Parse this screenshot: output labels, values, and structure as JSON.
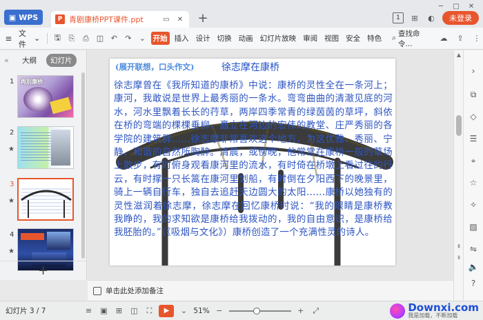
{
  "titlebar": {
    "wps_label": "WPS",
    "doc_name": "青剧康桥PPT课件.ppt",
    "page_badge": "1",
    "login": "未登录"
  },
  "ribbon": {
    "file_menu": "文件",
    "tabs": [
      "开始",
      "插入",
      "设计",
      "切换",
      "动画",
      "幻灯片放映",
      "审阅",
      "视图",
      "安全",
      "特色"
    ],
    "active_tab": "开始",
    "search_cmd": "查找命令..."
  },
  "left_panel": {
    "tab_outline": "大纲",
    "tab_slides": "幻灯片",
    "thumbs": [
      {
        "num": "1",
        "caption": "再别康桥"
      },
      {
        "num": "2"
      },
      {
        "num": "3"
      },
      {
        "num": "4"
      }
    ]
  },
  "slide": {
    "subtitle": "(展开联想，口头作文)",
    "title": "徐志摩在康桥",
    "body": "徐志摩曾在《我所知道的康桥》中说：康桥的灵性全在一条河上；康河，我敢说是世界上最秀丽的一条水。弯弯曲曲的清澈见底的河水，河水里飘着长长的荇草，两岸四季常青的绿茵茵的草坪，斜依在桥的弯端的棵棵垂柳，矗立在河边的宏伟的教堂、庄严秀丽的各学院的建筑群……徐志摩非常喜欢这个地方，为这优雅、秀丽、宁静、和谐的自然所陶醉。清晨，或傍晚，他常常在康桥一般的草场上散步，有时俯身观看康河里的流水，有时倚在桥墩上看过往的行云，有时撑一只长篙在康河里划船，有时倒在夕阳西下的晚景里，骑上一辆自行车，独自去追赶天边圆大的太阳……康桥以她独有的灵性滋润着徐志摩，徐志摩在回忆康桥时说：“我的眼睛是康桥教我睁的，我的求知欲是康桥给我拨动的，我的自由意识，是康桥给我胚胎的。”（《吸烟与文化》）康桥创造了一个充满性灵的诗人。"
  },
  "notes": {
    "placeholder": "单击此处添加备注"
  },
  "status": {
    "slide_counter": "幻灯片 3 / 7",
    "zoom": "51%",
    "zoom_fraction": 0.45
  },
  "watermark": {
    "main": "Downxi.com",
    "sub": "我是加载，不断加载"
  },
  "colors": {
    "accent": "#e8552d",
    "wps_blue": "#3a6ecf",
    "slide_text": "#2e56c2"
  }
}
